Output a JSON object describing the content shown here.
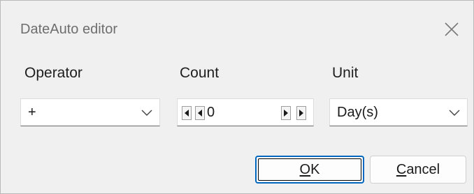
{
  "window": {
    "title": "DateAuto editor",
    "close_icon": "close-icon"
  },
  "operator": {
    "label": "Operator",
    "value": "+"
  },
  "count": {
    "label": "Count",
    "value": "0"
  },
  "unit": {
    "label": "Unit",
    "value": "Day(s)"
  },
  "buttons": {
    "ok_mnemonic": "O",
    "ok_rest": "K",
    "cancel_mnemonic": "C",
    "cancel_rest": "ancel"
  },
  "colors": {
    "accent": "#0067c0",
    "window_bg": "#f0f0f0"
  }
}
